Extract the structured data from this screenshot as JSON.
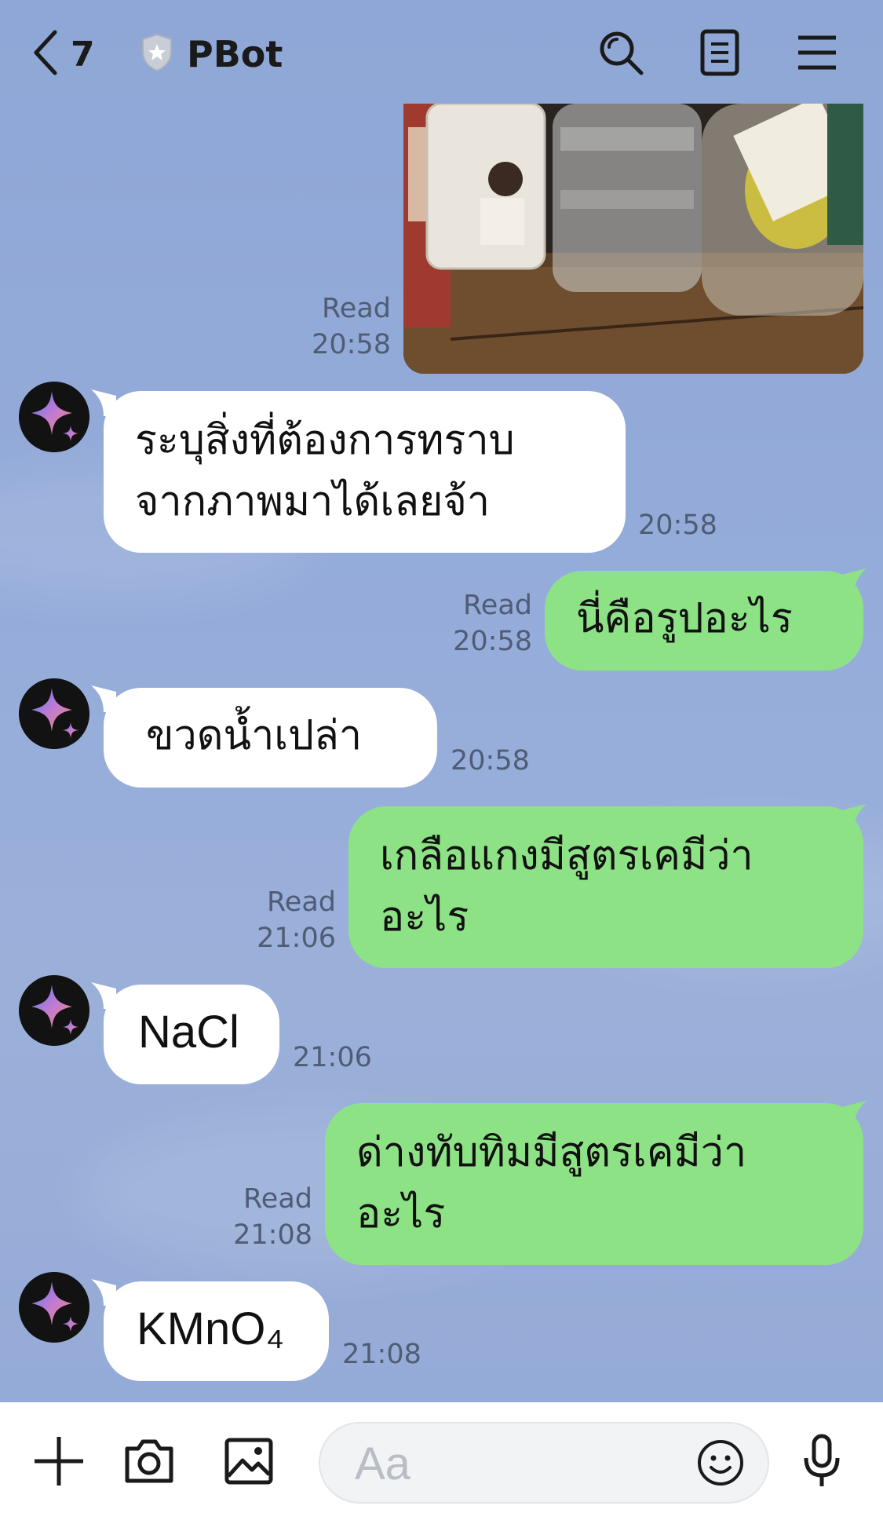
{
  "header": {
    "back_count": "7",
    "title": "PBot"
  },
  "messages": [
    {
      "side": "out",
      "type": "image",
      "read": "Read",
      "time": "20:58",
      "image_alt": "bottles-photo"
    },
    {
      "side": "in",
      "lines": [
        "ระบุสิ่งที่ต้องการทราบ",
        "จากภาพมาได้เลยจ้า"
      ],
      "time": "20:58"
    },
    {
      "side": "out",
      "lines": [
        "นี่คือรูปอะไร"
      ],
      "read": "Read",
      "time": "20:58"
    },
    {
      "side": "in",
      "lines": [
        "ขวดน้ำเปล่า"
      ],
      "time": "20:58"
    },
    {
      "side": "out",
      "lines": [
        "เกลือแกงมีสูตรเคมีว่า",
        "อะไร"
      ],
      "read": "Read",
      "time": "21:06"
    },
    {
      "side": "in",
      "lines": [
        "NaCl"
      ],
      "time": "21:06"
    },
    {
      "side": "out",
      "lines": [
        "ด่างทับทิมมีสูตรเคมีว่า",
        "อะไร"
      ],
      "read": "Read",
      "time": "21:08"
    },
    {
      "side": "in",
      "lines": [
        "KMnO₄"
      ],
      "time": "21:08"
    }
  ],
  "composer": {
    "placeholder": "Aa"
  },
  "colors": {
    "background": "#93a9d6",
    "bubble_out": "#8ee286",
    "bubble_in": "#ffffff"
  }
}
